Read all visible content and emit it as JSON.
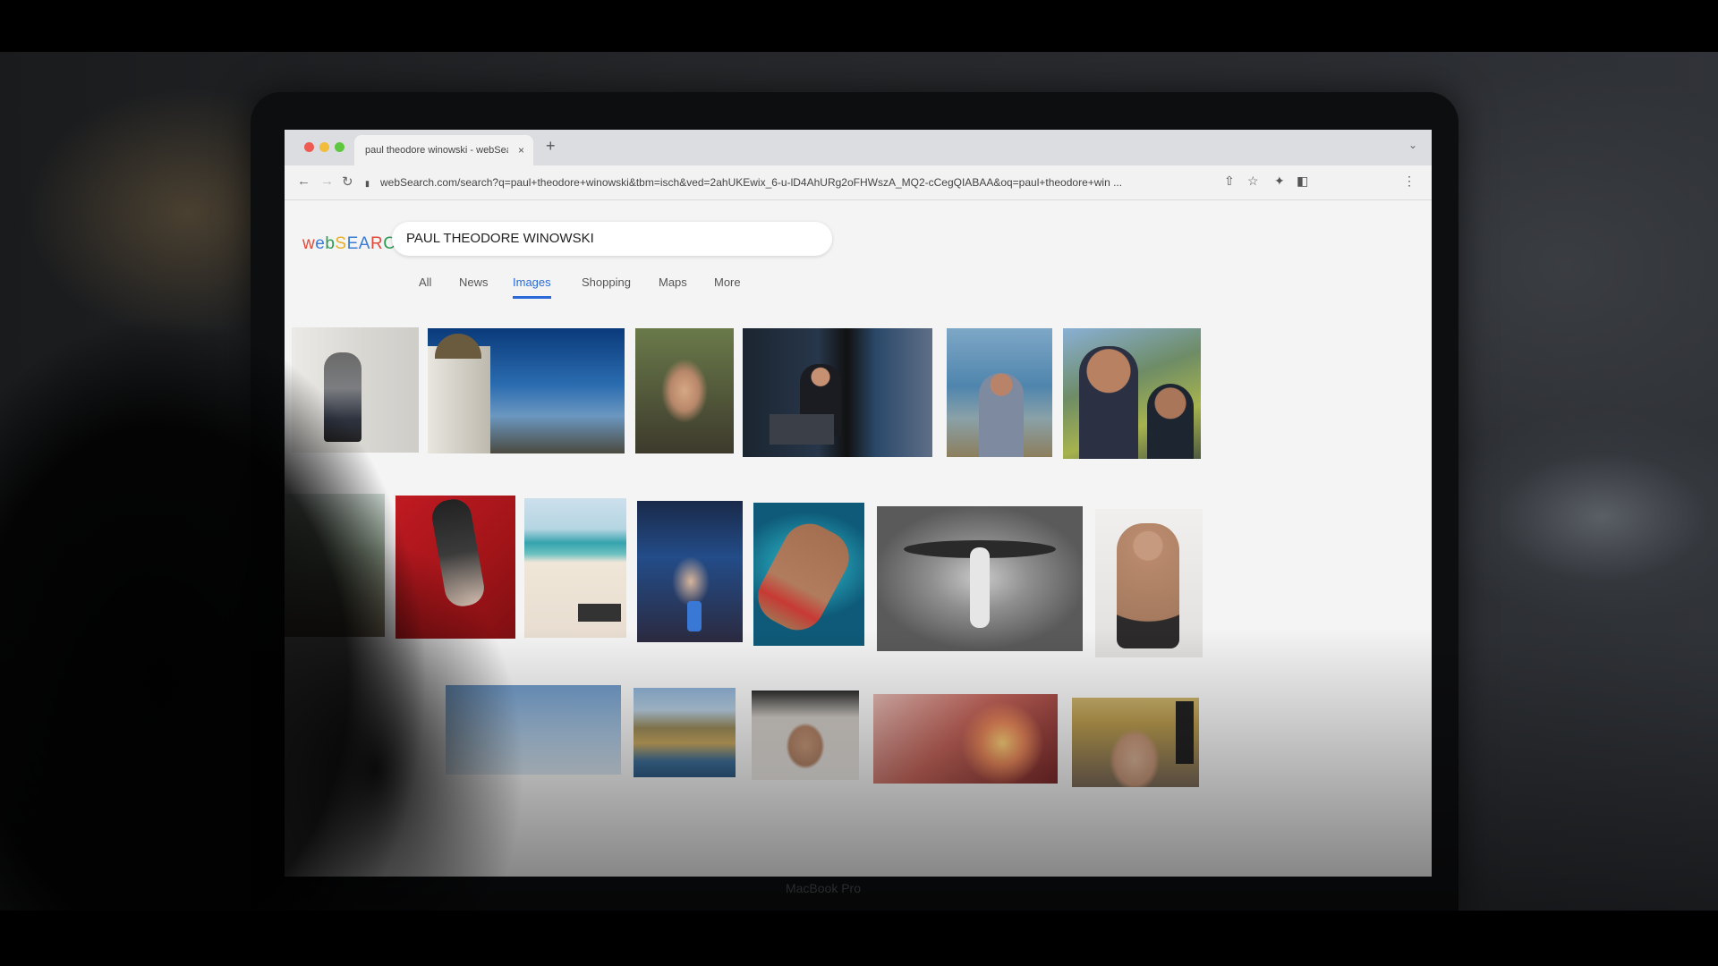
{
  "browser": {
    "tab_title": "paul theodore winowski - webSearch",
    "tab_close": "×",
    "new_tab": "+",
    "url": "webSearch.com/search?q=paul+theodore+winowski&tbm=isch&ved=2ahUKEwix_6-u-lD4AhURg2oFHWszA_MQ2-cCegQIABAA&oq=paul+theodore+win ..."
  },
  "search": {
    "logo": "webSEARCH",
    "query": "PAUL THEODORE WINOWSKI",
    "tabs": [
      "All",
      "News",
      "Images",
      "Shopping",
      "Maps",
      "More"
    ],
    "active_tab": "Images"
  },
  "device": {
    "brand": "MacBook Pro"
  },
  "colors": {
    "accent": "#2a6ad8",
    "logo_letters": [
      "#e04a3a",
      "#3a7bd5",
      "#2a9a52",
      "#e8b02a",
      "#3a7bd5",
      "#3a7bd5",
      "#e04a3a",
      "#2a9a52",
      "#3a7bd5"
    ]
  },
  "images": [
    {
      "name": "man-grey-sweater-photo",
      "row": 1
    },
    {
      "name": "observatory-city-view-photo",
      "row": 1
    },
    {
      "name": "woman-selfie-photo",
      "row": 1
    },
    {
      "name": "man-laptop-night-photo",
      "row": 1
    },
    {
      "name": "man-beach-wave-photo",
      "row": 1
    },
    {
      "name": "couple-selfie-coast-photo",
      "row": 1
    },
    {
      "name": "woman-palm-trees-photo",
      "row": 2
    },
    {
      "name": "couple-red-floor-photo",
      "row": 2
    },
    {
      "name": "beach-palms-photo",
      "row": 2
    },
    {
      "name": "friends-party-selfie-photo",
      "row": 2
    },
    {
      "name": "man-pool-float-photo",
      "row": 2
    },
    {
      "name": "bird-wings-art-photo",
      "row": 2
    },
    {
      "name": "woman-sitting-photo",
      "row": 2
    },
    {
      "name": "sky-clouds-photo",
      "row": 3
    },
    {
      "name": "coastal-cliffs-photo",
      "row": 3
    },
    {
      "name": "man-portrait-photo",
      "row": 3
    },
    {
      "name": "dinner-toast-photo",
      "row": 3
    },
    {
      "name": "blond-man-portrait-photo",
      "row": 3
    }
  ]
}
